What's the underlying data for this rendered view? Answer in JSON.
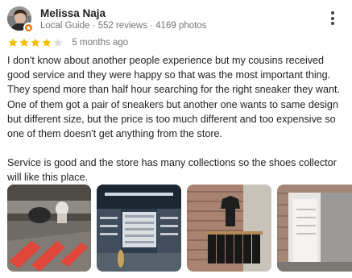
{
  "reviewer": {
    "name": "Melissa Naja",
    "meta": "Local Guide · 552 reviews · 4169 photos",
    "badge_icon": "local-guide-star-icon",
    "badge_color": "#e8710a"
  },
  "rating": {
    "stars": 4,
    "max": 5,
    "star_color": "#fbbc04",
    "empty_color": "#dadce0",
    "date": "5 months ago"
  },
  "review": {
    "paragraphs": [
      "I don't know about another people experience but my cousins received good service and they were happy so that was the most important thing. They spend more than half hour searching for the right sneaker they want. One of them got a pair of sneakers but another one wants to same design but different size, but the price is too much different and too expensive so one of them doesn't get anything from the store.",
      "Service is good and the store has many collections so the shoes collector will like this place."
    ]
  },
  "photos": [
    {
      "name": "photo-store-floor-logo"
    },
    {
      "name": "photo-store-interior-shelves"
    },
    {
      "name": "photo-clothing-rack-brick-wall"
    },
    {
      "name": "photo-store-entrance"
    }
  ],
  "menu": {
    "icon": "more-vert-icon"
  }
}
